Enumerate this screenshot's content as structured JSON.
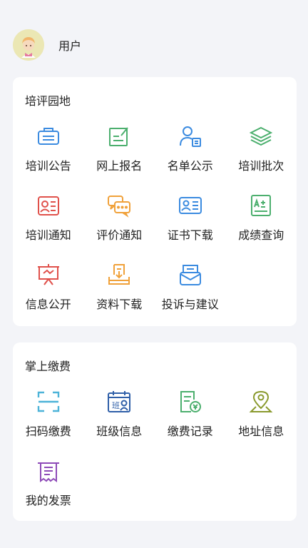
{
  "user": {
    "name": "用户"
  },
  "sections": [
    {
      "title": "培评园地",
      "items": [
        {
          "label": "培训公告",
          "icon": "announcement-icon",
          "color": "#3b8be0"
        },
        {
          "label": "网上报名",
          "icon": "edit-form-icon",
          "color": "#4caf6e"
        },
        {
          "label": "名单公示",
          "icon": "user-list-icon",
          "color": "#3b8be0"
        },
        {
          "label": "培训批次",
          "icon": "layers-icon",
          "color": "#4caf6e"
        },
        {
          "label": "培训通知",
          "icon": "notice-icon",
          "color": "#e0514b"
        },
        {
          "label": "评价通知",
          "icon": "chat-icon",
          "color": "#f0a13a"
        },
        {
          "label": "证书下载",
          "icon": "id-card-icon",
          "color": "#3b8be0"
        },
        {
          "label": "成绩查询",
          "icon": "score-icon",
          "color": "#4caf6e"
        },
        {
          "label": "信息公开",
          "icon": "board-icon",
          "color": "#e0514b"
        },
        {
          "label": "资料下载",
          "icon": "download-icon",
          "color": "#f0a13a"
        },
        {
          "label": "投诉与建议",
          "icon": "mail-icon",
          "color": "#3b8be0"
        }
      ]
    },
    {
      "title": "掌上缴费",
      "items": [
        {
          "label": "扫码缴费",
          "icon": "scan-icon",
          "color": "#4db3d8"
        },
        {
          "label": "班级信息",
          "icon": "class-calendar-icon",
          "color": "#2f5fa8",
          "glyph": "班"
        },
        {
          "label": "缴费记录",
          "icon": "payment-record-icon",
          "color": "#4caf6e"
        },
        {
          "label": "地址信息",
          "icon": "location-icon",
          "color": "#8a9a2e"
        },
        {
          "label": "我的发票",
          "icon": "invoice-icon",
          "color": "#8e4bb8"
        }
      ]
    }
  ]
}
